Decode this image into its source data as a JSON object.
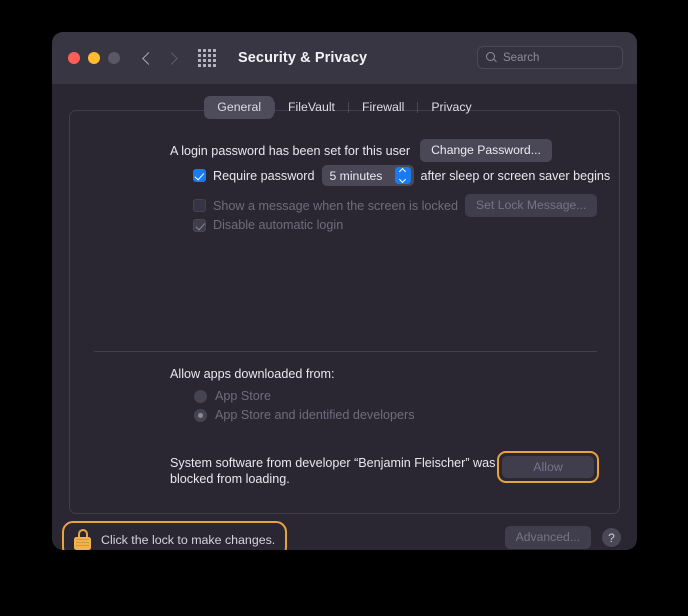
{
  "window": {
    "title": "Security & Privacy",
    "traffic_lights": [
      {
        "name": "close",
        "color": "#ff5f57"
      },
      {
        "name": "minimize",
        "color": "#ffbd2e"
      },
      {
        "name": "zoom",
        "color": "#5a5766"
      }
    ],
    "nav": {
      "back": "back-chevron",
      "forward": "forward-chevron"
    },
    "grid_button": "show-all-preferences-grid",
    "search": {
      "placeholder": "Search",
      "value": "",
      "icon": "search-icon"
    }
  },
  "tabs": [
    {
      "label": "General",
      "active": true
    },
    {
      "label": "FileVault",
      "active": false
    },
    {
      "label": "Firewall",
      "active": false
    },
    {
      "label": "Privacy",
      "active": false
    }
  ],
  "general": {
    "password_status": "A login password has been set for this user",
    "change_password_label": "Change Password...",
    "require_password": {
      "checked": true,
      "label": "Require password",
      "delay_value": "5 minutes",
      "suffix": "after sleep or screen saver begins"
    },
    "show_message": {
      "checked": false,
      "enabled": false,
      "label": "Show a message when the screen is locked",
      "button_label": "Set Lock Message..."
    },
    "disable_auto_login": {
      "checked": true,
      "enabled": false,
      "label": "Disable automatic login"
    },
    "allow_apps": {
      "heading": "Allow apps downloaded from:",
      "options": [
        {
          "label": "App Store",
          "selected": false
        },
        {
          "label": "App Store and identified developers",
          "selected": true
        }
      ]
    },
    "blocked_notice": {
      "text": "System software from developer “Benjamin Fleischer” was blocked from loading.",
      "button_label": "Allow",
      "button_enabled": false,
      "highlight_color": "#e8a33d"
    }
  },
  "footer": {
    "lock": {
      "icon": "lock-closed-icon",
      "text": "Click the lock to make changes.",
      "highlight_color": "#e8a33d"
    },
    "advanced_label": "Advanced...",
    "advanced_enabled": false,
    "help_label": "?"
  }
}
